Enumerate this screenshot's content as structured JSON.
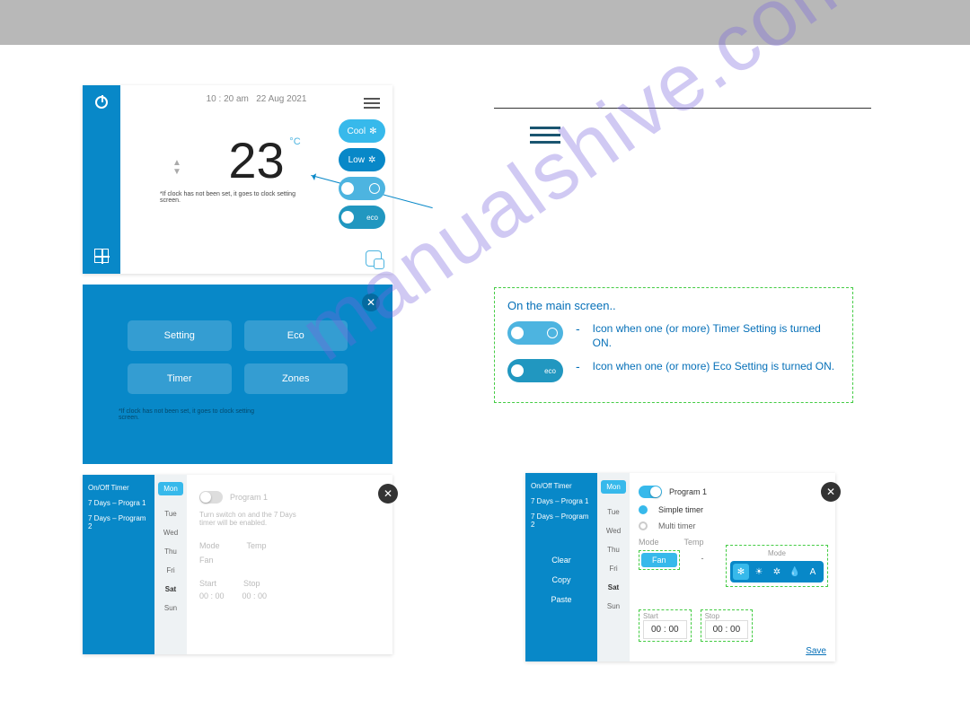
{
  "watermark": "manualshive.com",
  "panel1": {
    "time": "10 : 20 am",
    "date": "22 Aug 2021",
    "temp": "23",
    "unit": "°C",
    "note": "*If clock has not been set, it goes to clock setting screen.",
    "btn_cool": "Cool",
    "btn_low": "Low",
    "btn_eco": "eco"
  },
  "panel2": {
    "setting": "Setting",
    "eco": "Eco",
    "timer": "Timer",
    "zones": "Zones",
    "note": "*If clock has not been set, it goes to clock setting screen."
  },
  "timer_side": {
    "title": "On/Off Timer",
    "p1": "7 Days – Progra 1",
    "p2": "7 Days – Program 2",
    "clear": "Clear",
    "copy": "Copy",
    "paste": "Paste"
  },
  "days": {
    "mon": "Mon",
    "tue": "Tue",
    "wed": "Wed",
    "thu": "Thu",
    "fri": "Fri",
    "sat": "Sat",
    "sun": "Sun"
  },
  "panel3": {
    "prog": "Program 1",
    "hint": "Turn switch on and the 7 Days timer will be enabled.",
    "mode": "Mode",
    "temp": "Temp",
    "fan": "Fan",
    "start": "Start",
    "stop": "Stop",
    "t1": "00 : 00",
    "t2": "00 : 00"
  },
  "info": {
    "title": "On the main screen..",
    "eco": "eco",
    "line1": "Icon when one (or more) Timer Setting is turned ON.",
    "line2": "Icon when one (or more) Eco Setting is turned ON."
  },
  "panel4": {
    "prog": "Program 1",
    "simple": "Simple  timer",
    "multi": "Multi  timer",
    "mode": "Mode",
    "temp": "Temp",
    "fan": "Fan",
    "dash": "-",
    "mode_lbl": "Mode",
    "start": "Start",
    "stop": "Stop",
    "t1": "00 : 00",
    "t2": "00 : 00",
    "save": "Save",
    "A": "A"
  }
}
